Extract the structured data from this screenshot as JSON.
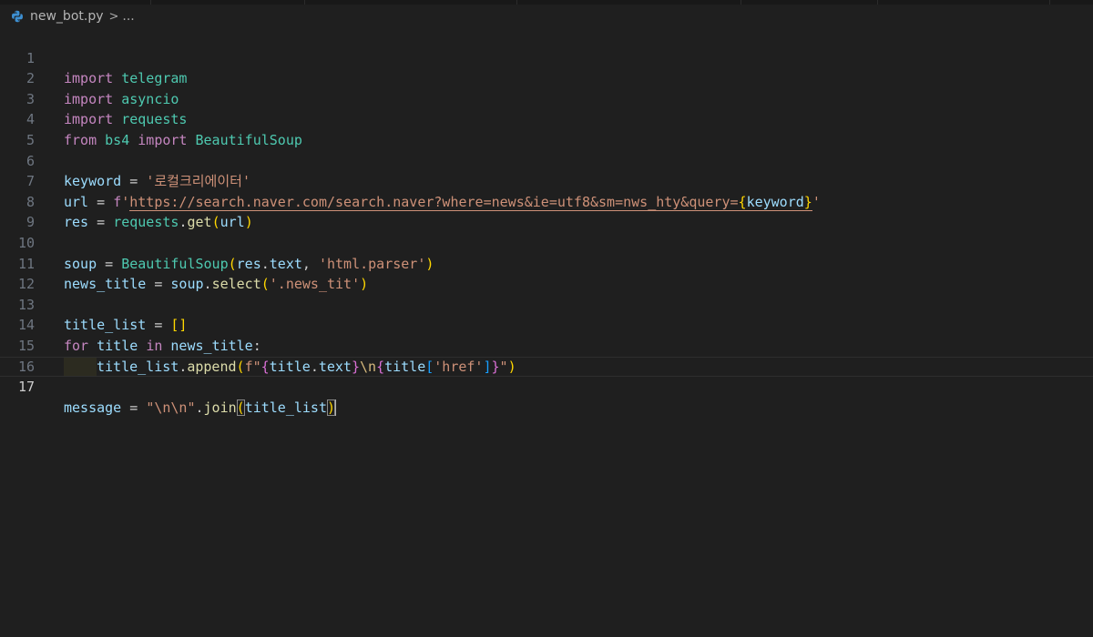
{
  "breadcrumb": {
    "file_name": "new_bot.py",
    "separator": ">",
    "more": "..."
  },
  "icons": {
    "file_type": "python-icon",
    "separator": "chevron-right-icon"
  },
  "colors": {
    "background": "#1f1f1f",
    "keyword": "#c586c0",
    "module": "#4ec9b0",
    "variable": "#9cdcfe",
    "function": "#dcdcaa",
    "string": "#ce9178",
    "bracket_gold": "#ffd700",
    "bracket_purple": "#da70d6",
    "bracket_blue": "#179fff"
  },
  "editor": {
    "active_line": 17,
    "lines": [
      {
        "n": "1"
      },
      {
        "n": "2"
      },
      {
        "n": "3"
      },
      {
        "n": "4"
      },
      {
        "n": "5"
      },
      {
        "n": "6"
      },
      {
        "n": "7"
      },
      {
        "n": "8"
      },
      {
        "n": "9"
      },
      {
        "n": "10"
      },
      {
        "n": "11"
      },
      {
        "n": "12"
      },
      {
        "n": "13"
      },
      {
        "n": "14"
      },
      {
        "n": "15"
      },
      {
        "n": "16"
      },
      {
        "n": "17"
      }
    ],
    "tokens": {
      "import": "import",
      "from": "from",
      "for": "for",
      "in": "in",
      "telegram": "telegram",
      "asyncio": "asyncio",
      "requests": "requests",
      "bs4": "bs4",
      "BeautifulSoup": "BeautifulSoup",
      "keyword_var": "keyword",
      "eq": " = ",
      "keyword_value": "'로컬크리에이터'",
      "url_var": "url",
      "f_prefix": "f",
      "quote": "'",
      "url_text": "https://search.naver.com/search.naver?where=news&ie=utf8&sm=nws_hty&query=",
      "lbrace": "{",
      "rbrace": "}",
      "res": "res",
      "dot": ".",
      "get": "get",
      "lparen": "(",
      "rparen": ")",
      "soup": "soup",
      "text": "text",
      "comma": ", ",
      "parser": "'html.parser'",
      "news_title": "news_title",
      "select": "select",
      "selector": "'.news_tit'",
      "title_list": "title_list",
      "empty_list": "[]",
      "title": "title",
      "colon": ":",
      "append": "append",
      "fdq": "f\"",
      "esc_n": "\\n",
      "lbracket": "[",
      "rbracket": "]",
      "href": "'href'",
      "dq": "\"",
      "message": "message",
      "join_str": "\"\\n\\n\"",
      "join": "join"
    }
  }
}
